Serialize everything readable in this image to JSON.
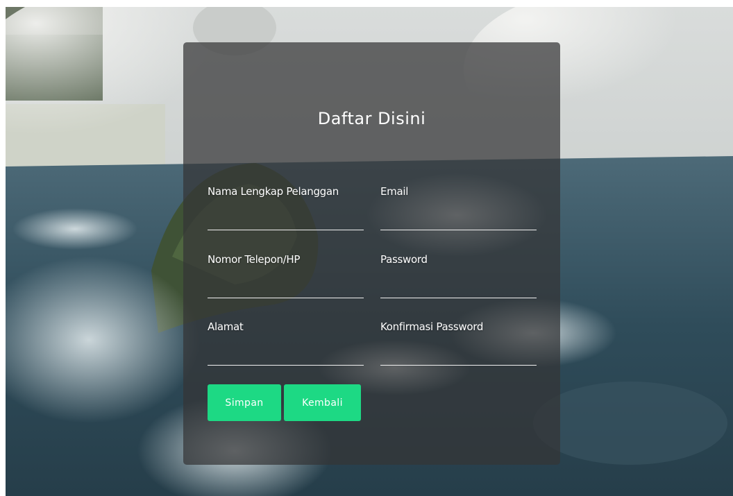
{
  "form": {
    "title": "Daftar Disini",
    "fields": {
      "nama": {
        "label": "Nama Lengkap Pelanggan",
        "value": ""
      },
      "email": {
        "label": "Email",
        "value": ""
      },
      "telepon": {
        "label": "Nomor Telepon/HP",
        "value": ""
      },
      "password": {
        "label": "Password",
        "value": ""
      },
      "alamat": {
        "label": "Alamat",
        "value": ""
      },
      "konfirmasi": {
        "label": "Konfirmasi Password",
        "value": ""
      }
    },
    "buttons": {
      "save_label": "Simpan",
      "back_label": "Kembali"
    }
  },
  "colors": {
    "accent": "#1dd984",
    "card": "#343436"
  }
}
